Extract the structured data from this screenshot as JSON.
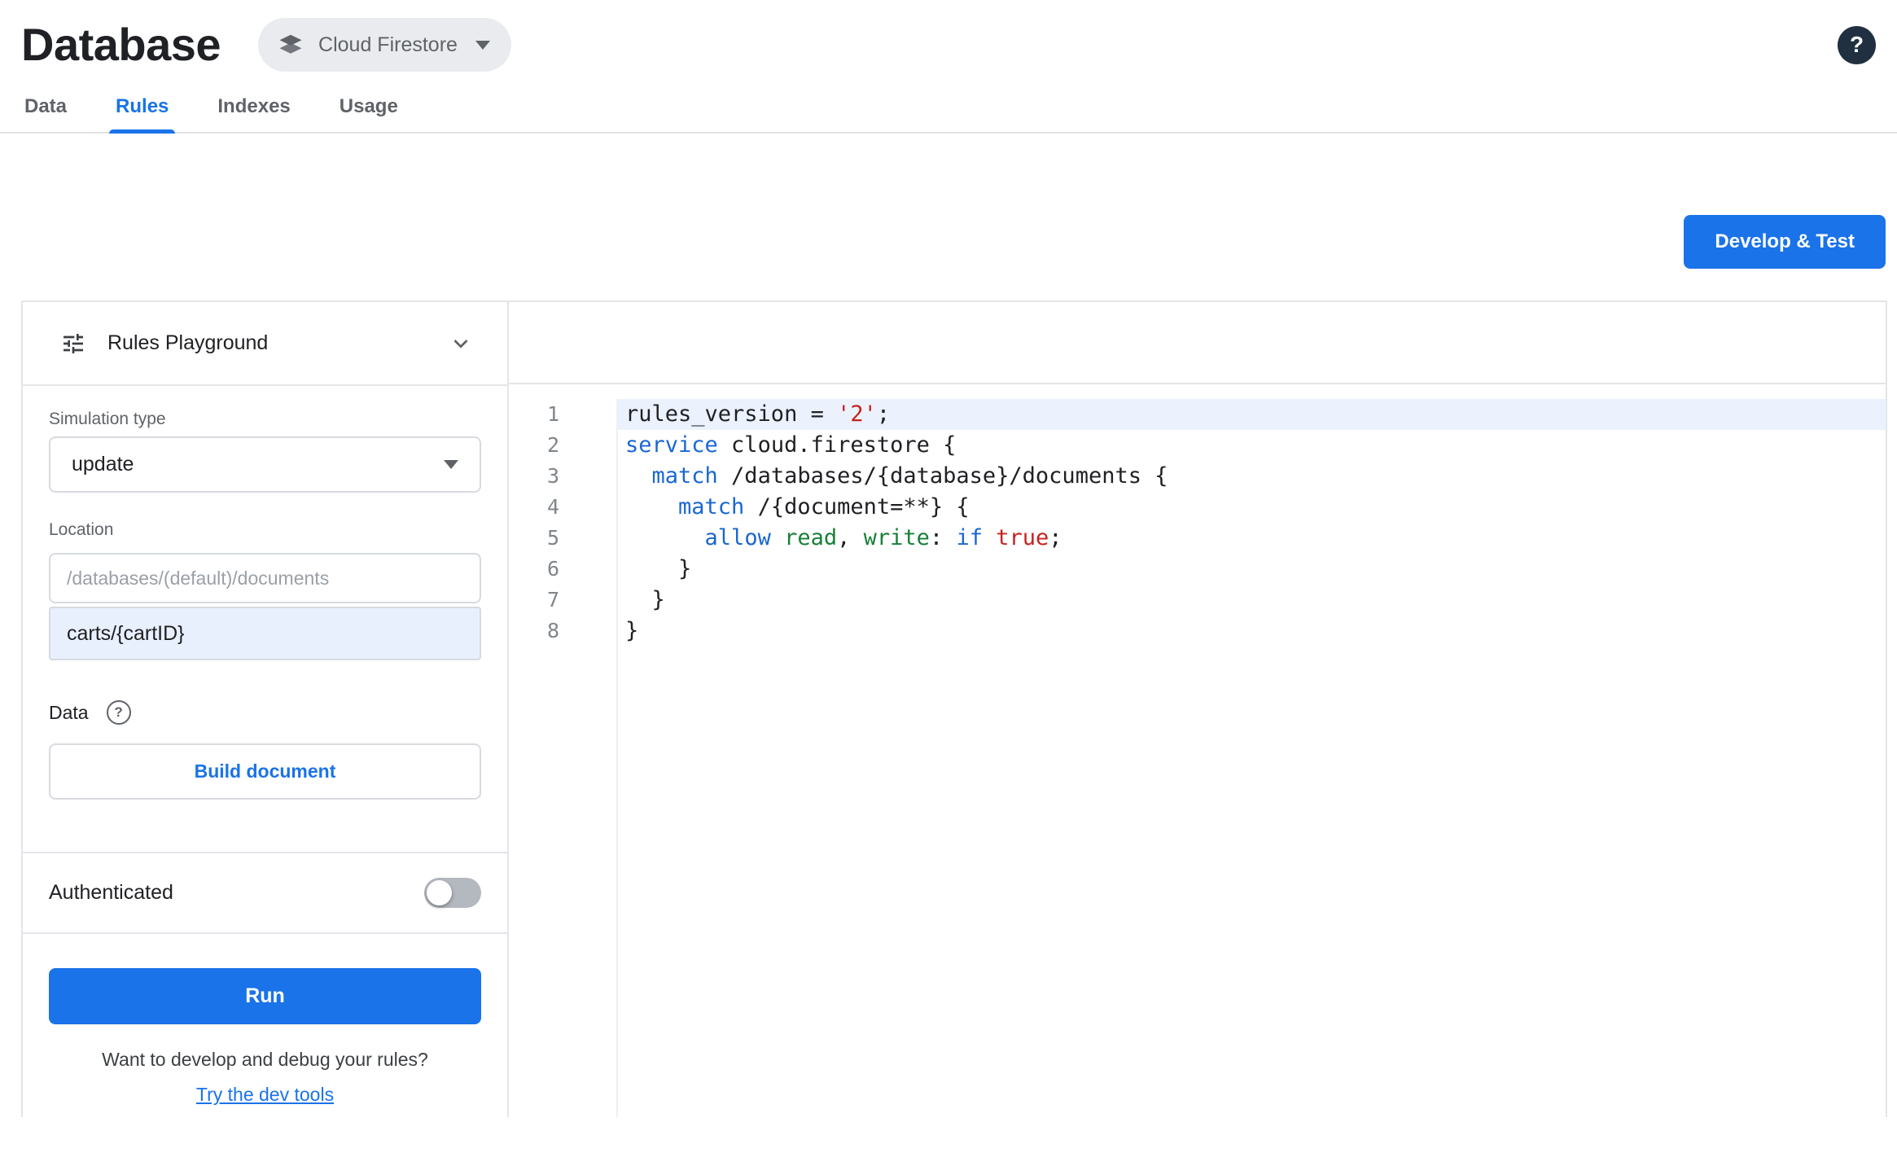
{
  "header": {
    "title": "Database",
    "product_chip": {
      "label": "Cloud Firestore"
    },
    "help_glyph": "?"
  },
  "tabs": [
    {
      "label": "Data",
      "active": false
    },
    {
      "label": "Rules",
      "active": true
    },
    {
      "label": "Indexes",
      "active": false
    },
    {
      "label": "Usage",
      "active": false
    }
  ],
  "actions": {
    "develop_test_label": "Develop & Test"
  },
  "playground": {
    "title": "Rules Playground",
    "simulation_type": {
      "label": "Simulation type",
      "value": "update"
    },
    "location": {
      "label": "Location",
      "placeholder": "/databases/(default)/documents",
      "value": "carts/{cartID}"
    },
    "data_section": {
      "label": "Data",
      "help_glyph": "?",
      "build_button_label": "Build document"
    },
    "auth": {
      "label": "Authenticated",
      "enabled": false
    },
    "run_button_label": "Run",
    "footer": {
      "text": "Want to develop and debug your rules?",
      "link_label": "Try the dev tools"
    }
  },
  "editor": {
    "lines": [
      {
        "number": 1,
        "highlight": true,
        "tokens": [
          {
            "type": "plain",
            "text": "rules_version = "
          },
          {
            "type": "literal",
            "text": "'2'"
          },
          {
            "type": "plain",
            "text": ";"
          }
        ]
      },
      {
        "number": 2,
        "highlight": false,
        "tokens": [
          {
            "type": "keyword",
            "text": "service"
          },
          {
            "type": "plain",
            "text": " cloud.firestore {"
          }
        ]
      },
      {
        "number": 3,
        "highlight": false,
        "tokens": [
          {
            "type": "plain",
            "text": "  "
          },
          {
            "type": "keyword",
            "text": "match"
          },
          {
            "type": "plain",
            "text": " /databases/{database}/documents {"
          }
        ]
      },
      {
        "number": 4,
        "highlight": false,
        "tokens": [
          {
            "type": "plain",
            "text": "    "
          },
          {
            "type": "keyword",
            "text": "match"
          },
          {
            "type": "plain",
            "text": " /{document=**} {"
          }
        ]
      },
      {
        "number": 5,
        "highlight": false,
        "tokens": [
          {
            "type": "plain",
            "text": "      "
          },
          {
            "type": "keyword",
            "text": "allow"
          },
          {
            "type": "plain",
            "text": " "
          },
          {
            "type": "perm",
            "text": "read"
          },
          {
            "type": "plain",
            "text": ", "
          },
          {
            "type": "perm",
            "text": "write"
          },
          {
            "type": "plain",
            "text": ": "
          },
          {
            "type": "keyword",
            "text": "if"
          },
          {
            "type": "plain",
            "text": " "
          },
          {
            "type": "literal",
            "text": "true"
          },
          {
            "type": "plain",
            "text": ";"
          }
        ]
      },
      {
        "number": 6,
        "highlight": false,
        "tokens": [
          {
            "type": "plain",
            "text": "    }"
          }
        ]
      },
      {
        "number": 7,
        "highlight": false,
        "tokens": [
          {
            "type": "plain",
            "text": "  }"
          }
        ]
      },
      {
        "number": 8,
        "highlight": false,
        "tokens": [
          {
            "type": "plain",
            "text": "}"
          }
        ]
      }
    ]
  },
  "colors": {
    "accent": "#1a73e8",
    "keyword": "#1967d2",
    "permission": "#188038",
    "literal": "#c5221f",
    "line_highlight": "#ecf2fd",
    "help_badge": "#203040"
  }
}
